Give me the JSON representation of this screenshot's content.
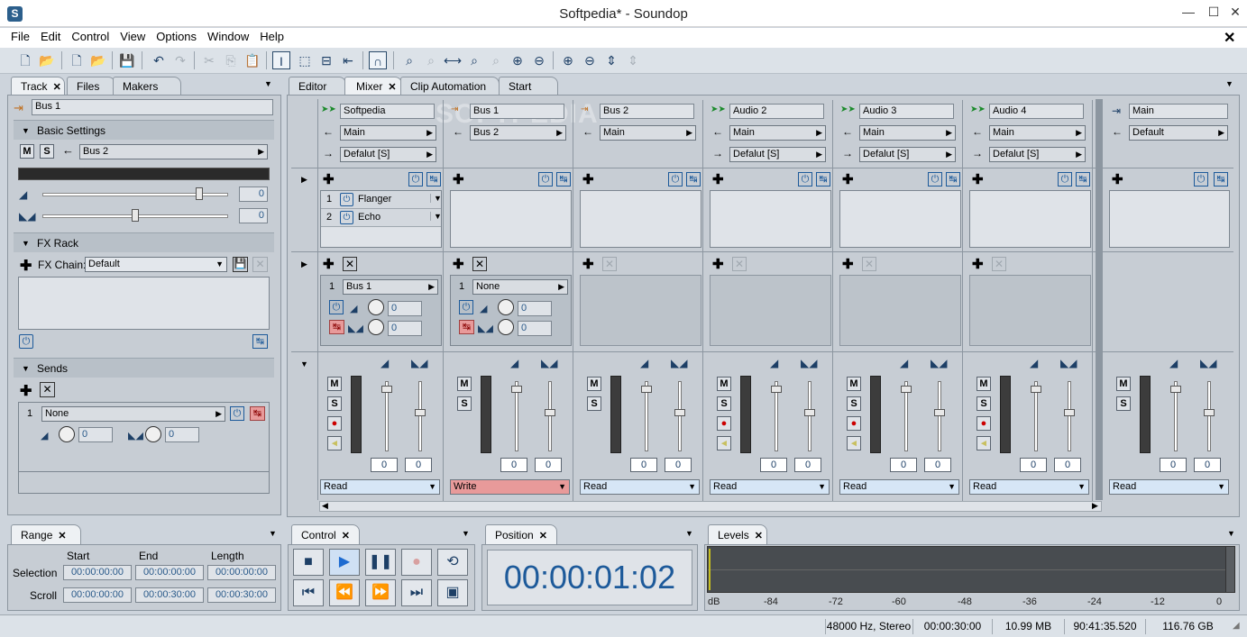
{
  "window": {
    "title": "Softpedia* - Soundop"
  },
  "menu": [
    "File",
    "Edit",
    "Control",
    "View",
    "Options",
    "Window",
    "Help"
  ],
  "left_tabs": [
    "Track",
    "Files",
    "Makers"
  ],
  "track_name": "Bus 1",
  "basic": {
    "title": "Basic Settings",
    "m": "M",
    "s": "S",
    "output": "Bus 2",
    "vol_value": "0",
    "pan_value": "0"
  },
  "fx": {
    "title": "FX Rack",
    "chain_label": "FX Chain:",
    "chain": "Default"
  },
  "sends": {
    "title": "Sends",
    "index": "1",
    "target": "None",
    "v1": "0",
    "v2": "0"
  },
  "main_tabs": [
    "Editor",
    "Mixer",
    "Clip Automation",
    "Start"
  ],
  "strips": [
    {
      "name": "Softpedia",
      "in": "Main",
      "out": "Defalut [S]",
      "fx": [
        {
          "i": "1",
          "n": "Flanger"
        },
        {
          "i": "2",
          "n": "Echo"
        }
      ],
      "send": {
        "i": "1",
        "n": "Bus 1",
        "v1": "0",
        "v2": "0"
      },
      "l": "0",
      "r": "0",
      "mode": "Read",
      "rec": true
    },
    {
      "name": "Bus 1",
      "in": "Bus 2",
      "out": "",
      "fx": [],
      "send": {
        "i": "1",
        "n": "None",
        "v1": "0",
        "v2": "0"
      },
      "l": "0",
      "r": "0",
      "mode": "Write",
      "rec": false
    },
    {
      "name": "Bus 2",
      "in": "Main",
      "out": "",
      "fx": [],
      "send": null,
      "l": "0",
      "r": "0",
      "mode": "Read",
      "rec": false
    },
    {
      "name": "Audio 2",
      "in": "Main",
      "out": "Defalut [S]",
      "fx": [],
      "send": null,
      "l": "0",
      "r": "0",
      "mode": "Read",
      "rec": true
    },
    {
      "name": "Audio 3",
      "in": "Main",
      "out": "Defalut [S]",
      "fx": [],
      "send": null,
      "l": "0",
      "r": "0",
      "mode": "Read",
      "rec": true
    },
    {
      "name": "Audio 4",
      "in": "Main",
      "out": "Defalut [S]",
      "fx": [],
      "send": null,
      "l": "0",
      "r": "0",
      "mode": "Read",
      "rec": true
    }
  ],
  "master": {
    "name": "Main",
    "out": "Default",
    "l": "0",
    "r": "0",
    "mode": "Read"
  },
  "range": {
    "tab": "Range",
    "start": "Start",
    "end": "End",
    "length": "Length",
    "selection": "Selection",
    "scroll": "Scroll",
    "sel": [
      "00:00:00:00",
      "00:00:00:00",
      "00:00:00:00"
    ],
    "scr": [
      "00:00:00:00",
      "00:00:30:00",
      "00:00:30:00"
    ]
  },
  "control_tab": "Control",
  "position": {
    "tab": "Position",
    "time": "00:00:01:02"
  },
  "levels": {
    "tab": "Levels",
    "ticks": [
      "dB",
      "-84",
      "-72",
      "-60",
      "-48",
      "-36",
      "-24",
      "-12",
      "0"
    ]
  },
  "status": [
    "48000 Hz, Stereo",
    "00:00:30:00",
    "10.99 MB",
    "90:41:35.520",
    "116.76 GB"
  ],
  "watermark": "SOFTPEDIA",
  "colors": {
    "write": "#e89a9a",
    "accent": "#1d5a9a",
    "bg": "#c7cdd4"
  }
}
